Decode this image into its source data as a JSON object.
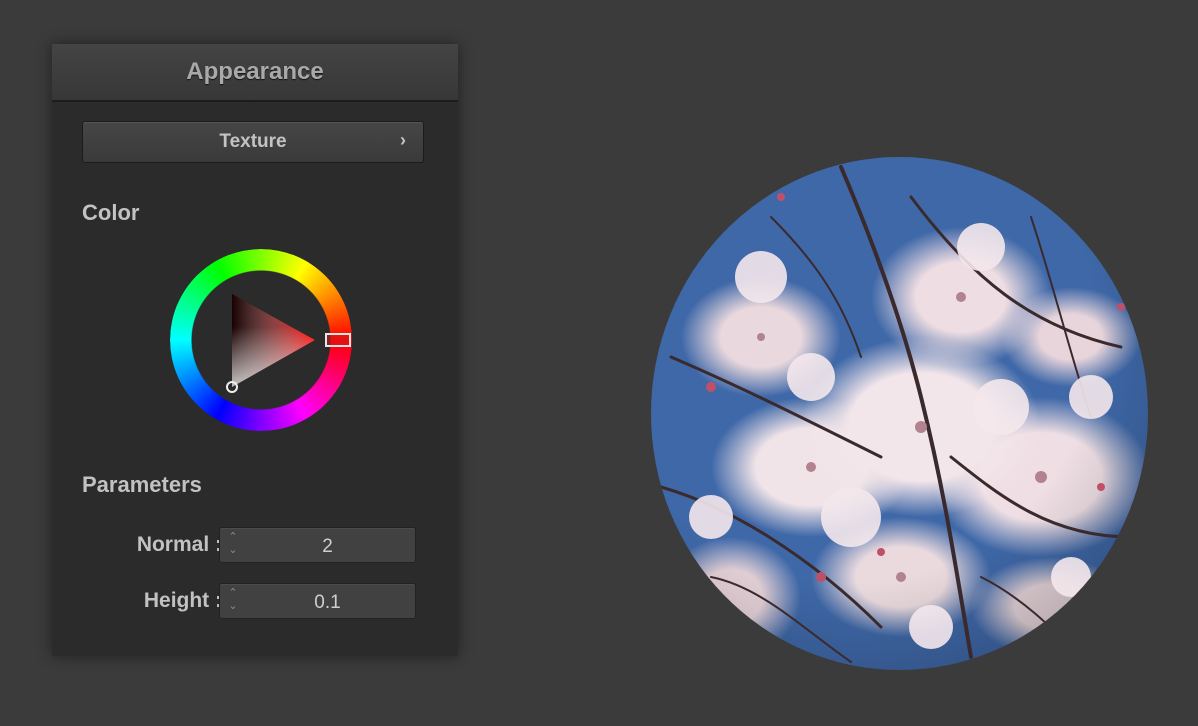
{
  "panel": {
    "title": "Appearance",
    "texture_button": {
      "label": "Texture",
      "chevron": "›"
    },
    "color_section": {
      "label": "Color",
      "selected_color": "#e01010"
    },
    "parameters_section": {
      "label": "Parameters",
      "fields": [
        {
          "label": "Normal :",
          "value": "2"
        },
        {
          "label": "Height :",
          "value": "0.1"
        }
      ]
    },
    "stepper_icons": {
      "up": "⌃",
      "down": "⌄"
    }
  },
  "viewport": {
    "object": "textured-sphere",
    "texture": "cherry-blossom"
  },
  "colors": {
    "background": "#3b3b3b",
    "panel": "#2b2b2b",
    "sky": "#3f68a8",
    "blossom": "#f1e3e7"
  }
}
